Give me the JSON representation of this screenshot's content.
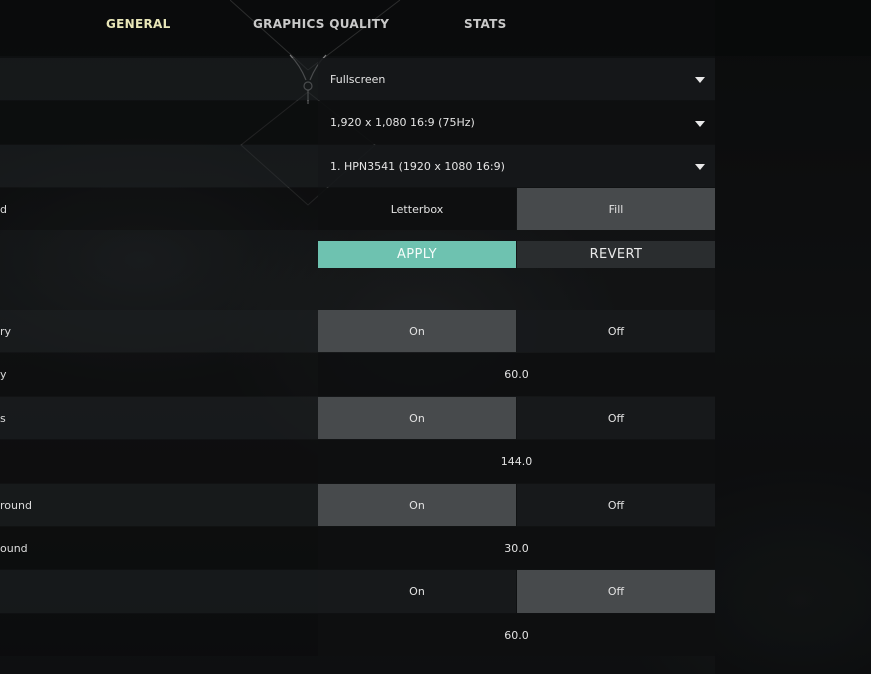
{
  "colors": {
    "accent": "#6ec2b0",
    "active_tab": "#e8e6b8",
    "selected_option": "#474a4c"
  },
  "tabs": [
    {
      "label": "GENERAL",
      "active": true
    },
    {
      "label": "GRAPHICS QUALITY",
      "active": false
    },
    {
      "label": "STATS",
      "active": false
    }
  ],
  "rows": {
    "display_mode": {
      "label": "",
      "value": "Fullscreen"
    },
    "resolution": {
      "label": "",
      "value": "1,920 x 1,080 16:9 (75Hz)"
    },
    "monitor": {
      "label": "",
      "value": "1. HPN3541 (1920 x  1080 16:9)"
    },
    "aspect_method": {
      "label": "d",
      "options": [
        "Letterbox",
        "Fill"
      ],
      "selected": "Fill"
    },
    "apply_revert": {
      "apply": "APPLY",
      "revert": "REVERT"
    },
    "limit_fps_battery": {
      "label": "ry",
      "options": [
        "On",
        "Off"
      ],
      "selected": "On"
    },
    "max_fps_battery": {
      "label": "y",
      "value": "60.0"
    },
    "limit_fps_always": {
      "label": "s",
      "options": [
        "On",
        "Off"
      ],
      "selected": "On"
    },
    "max_fps_always": {
      "label": "",
      "value": "144.0"
    },
    "limit_fps_background": {
      "label": "round",
      "options": [
        "On",
        "Off"
      ],
      "selected": "On"
    },
    "max_fps_background": {
      "label": "ound",
      "value": "30.0"
    },
    "limit_fps_menus": {
      "label": "",
      "options": [
        "On",
        "Off"
      ],
      "selected": "Off"
    },
    "max_fps_menus": {
      "label": "",
      "value": "60.0"
    }
  }
}
